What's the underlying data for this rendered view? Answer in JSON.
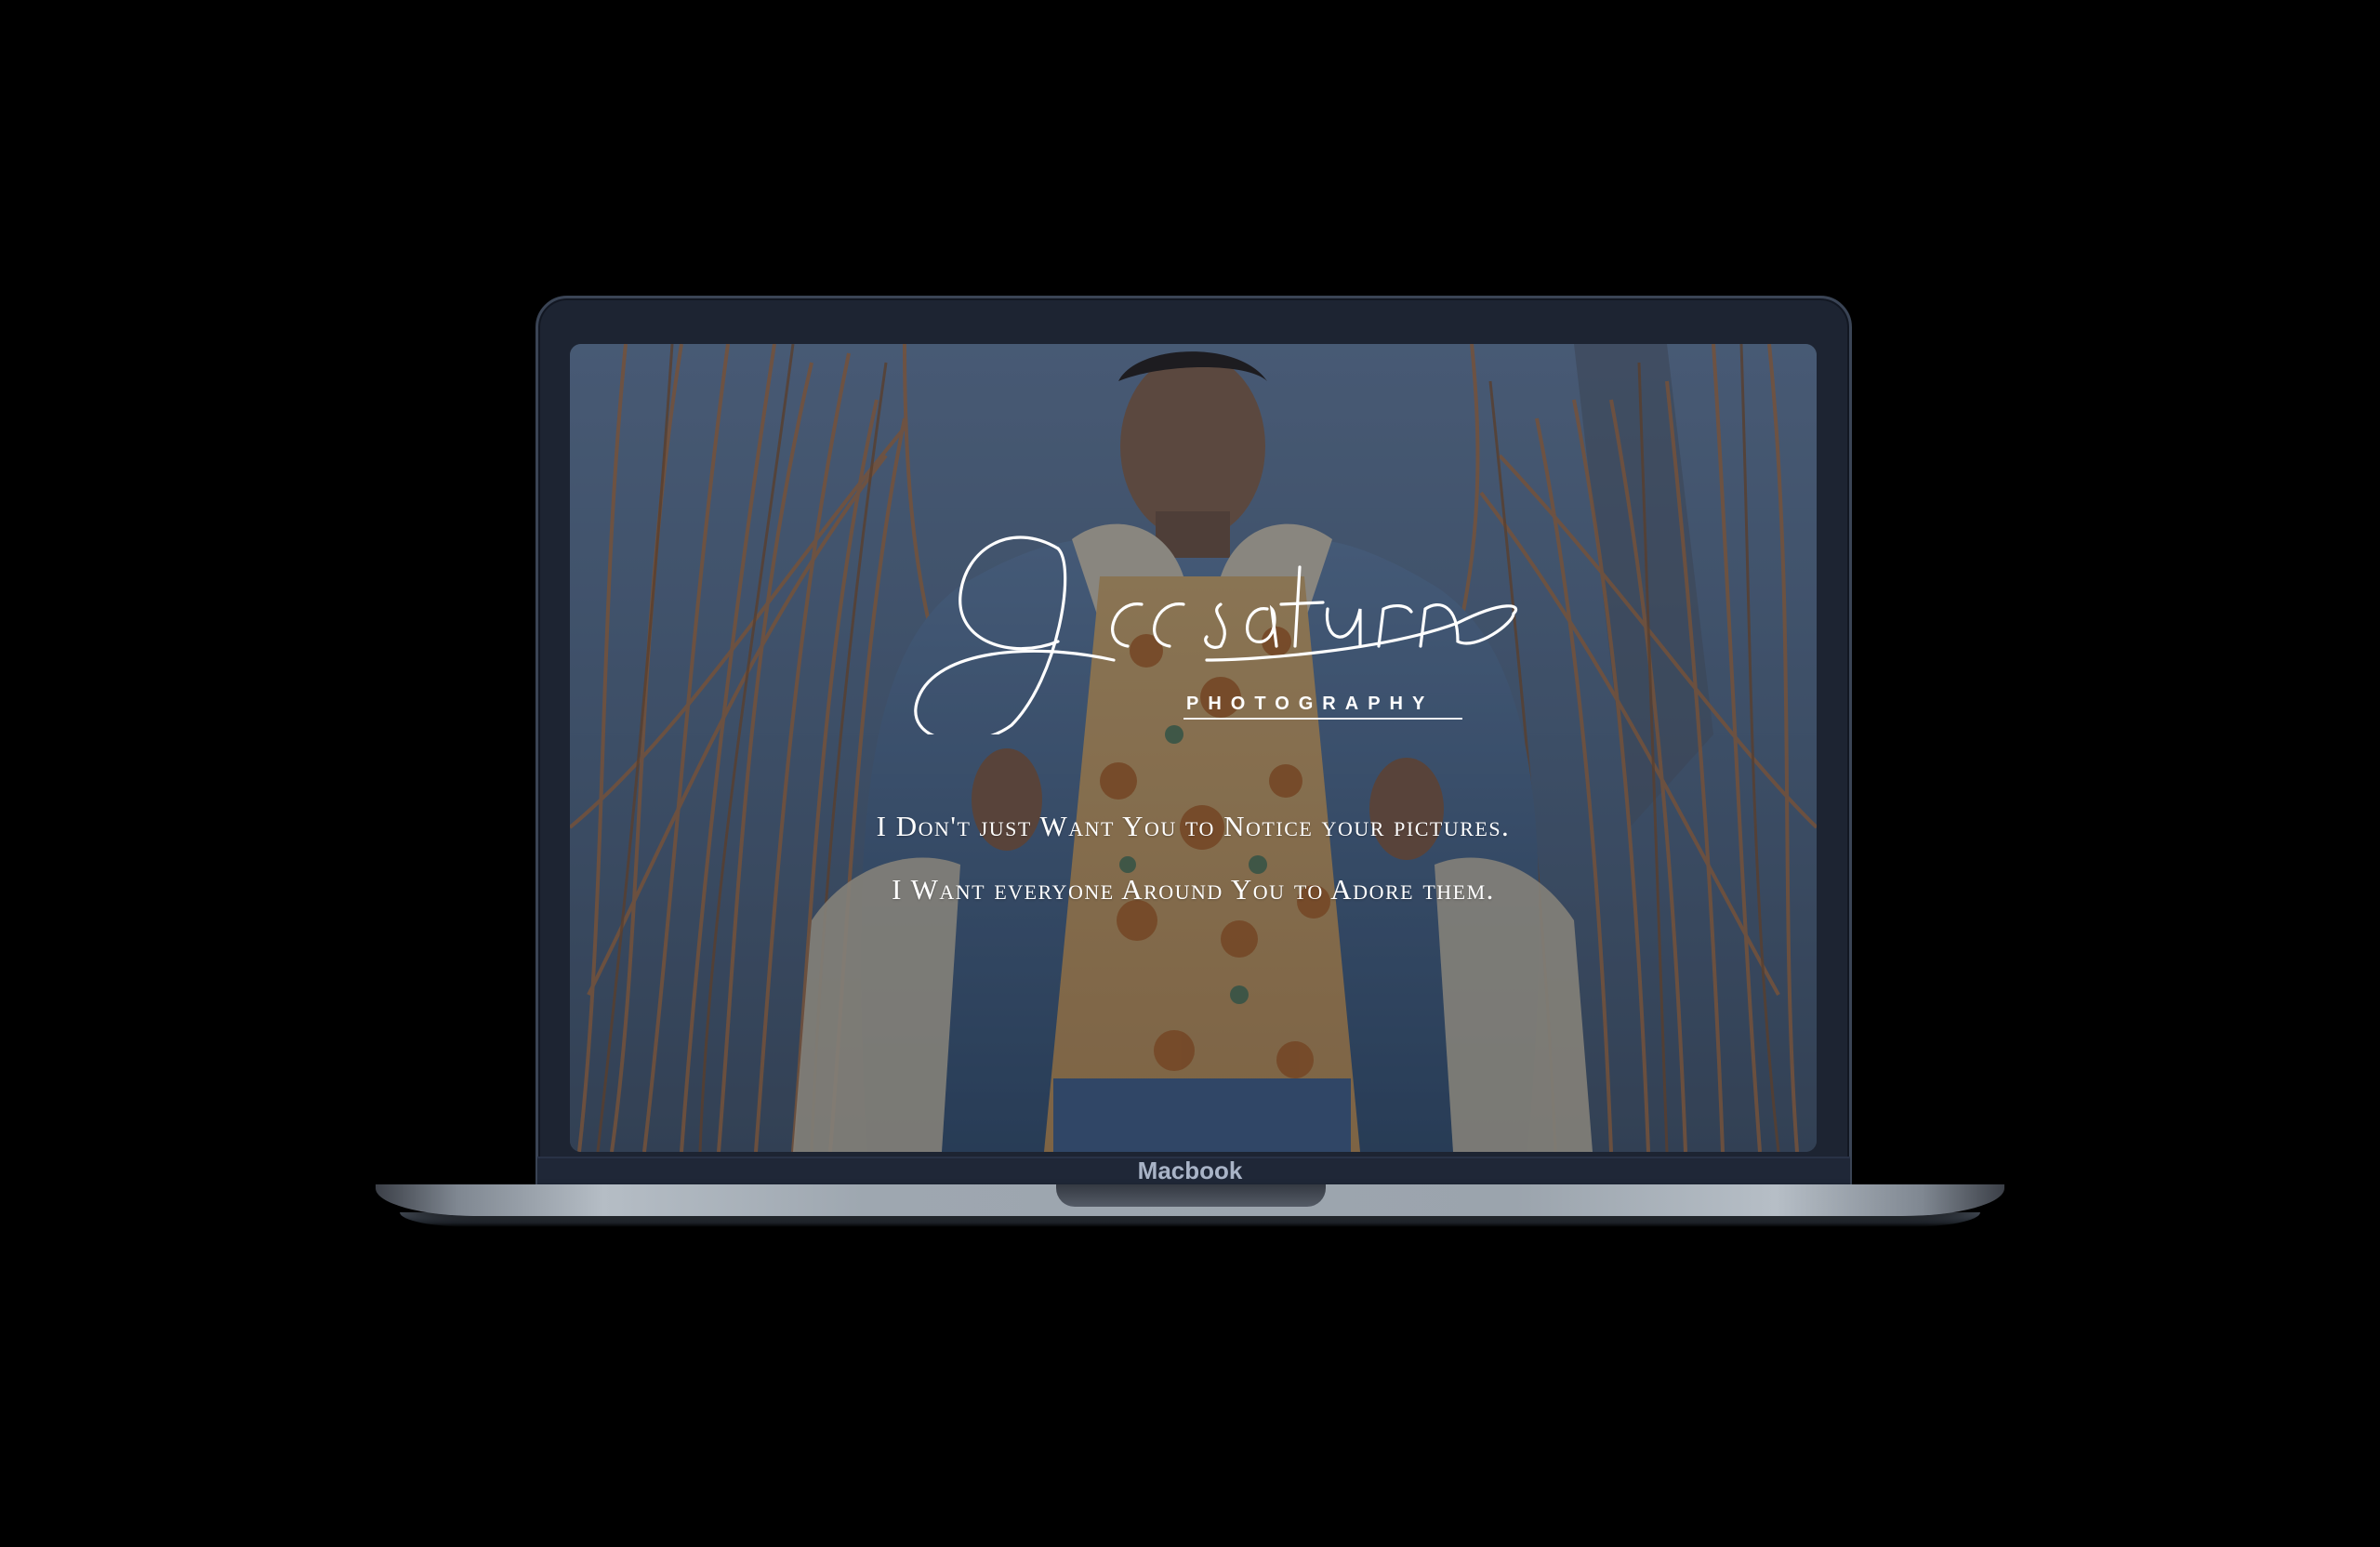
{
  "device": {
    "label": "Macbook"
  },
  "hero": {
    "logo_script": "Jccsaturn",
    "logo_sub": "PHOTOGRAPHY",
    "tagline_line1": "I Don't just Want You to Notice your pictures.",
    "tagline_line2": "I Want everyone Around You to Adore them."
  },
  "colors": {
    "background": "#000000",
    "screen_overlay": "#081223",
    "text": "#ffffff",
    "device_label": "#a9b4c7"
  }
}
